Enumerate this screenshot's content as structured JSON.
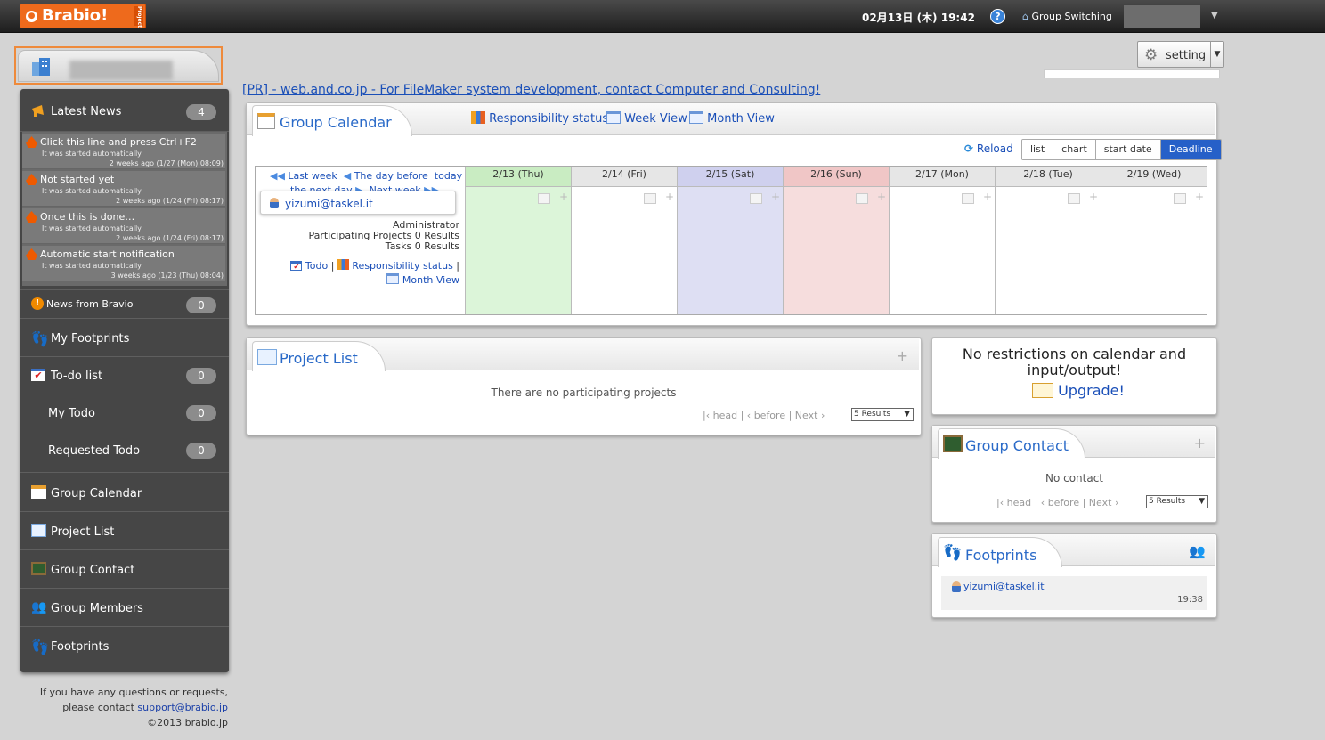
{
  "topbar": {
    "logo": "Brabio!",
    "logo_tag": "Project",
    "datetime": "02月13日 (木) 19:42",
    "help": "?",
    "group_switching": "Group Switching"
  },
  "setting": {
    "label": "setting"
  },
  "pr_link": "[PR] - web.and.co.jp - For FileMaker system development, contact Computer and Consulting!",
  "sidebar": {
    "latest_news": {
      "label": "Latest News",
      "count": "4"
    },
    "news": [
      {
        "title": "Click this line and press Ctrl+F2",
        "sub": "It was started automatically",
        "date": "2 weeks ago (1/27 (Mon) 08:09)"
      },
      {
        "title": "Not started yet",
        "sub": "It was started automatically",
        "date": "2 weeks ago (1/24 (Fri) 08:17)"
      },
      {
        "title": "Once this is done…",
        "sub": "It was started automatically",
        "date": "2 weeks ago (1/24 (Fri) 08:17)"
      },
      {
        "title": "Automatic start notification",
        "sub": "It was started automatically",
        "date": "3 weeks ago (1/23 (Thu) 08:04)"
      }
    ],
    "news_bravio": {
      "label": "News from Bravio",
      "count": "0"
    },
    "my_footprints": "My Footprints",
    "todo_list": {
      "label": "To-do list",
      "count": "0"
    },
    "my_todo": {
      "label": "My Todo",
      "count": "0"
    },
    "requested_todo": {
      "label": "Requested Todo",
      "count": "0"
    },
    "group_calendar": "Group Calendar",
    "project_list": "Project List",
    "group_contact": "Group Contact",
    "group_members": "Group Members",
    "footprints": "Footprints"
  },
  "footer": {
    "line1": "If you have any questions or requests,",
    "line2": "please contact",
    "email": "support@brabio.jp",
    "copyright": "©2013 brabio.jp"
  },
  "calendar": {
    "title": "Group Calendar",
    "links": [
      "Responsibility status",
      "Week View",
      "Month View"
    ],
    "reload": "Reload",
    "view_buttons": [
      "list",
      "chart",
      "start date",
      "Deadline"
    ],
    "nav": {
      "last_week": "Last week",
      "day_before": "The day before",
      "today": "today",
      "next_day": "the next day",
      "next_week": "Next week"
    },
    "user": "yizumi@taskel.it",
    "role": "Administrator",
    "participating_projects": "Participating Projects",
    "projects_count": "0 Results",
    "tasks": "Tasks",
    "tasks_count": "0 Results",
    "user_links": [
      "Todo",
      "Responsibility status",
      "Month View"
    ],
    "days": [
      "2/13 (Thu)",
      "2/14 (Fri)",
      "2/15 (Sat)",
      "2/16 (Sun)",
      "2/17 (Mon)",
      "2/18 (Tue)",
      "2/19 (Wed)"
    ],
    "day_colors": [
      "#dcf5d9",
      "#ffffff",
      "#dedff3",
      "#f6dddd",
      "#ffffff",
      "#ffffff",
      "#ffffff"
    ],
    "header_colors": [
      "#c9ecc2",
      "#e6e6e6",
      "#cfd0ee",
      "#f0c6c6",
      "#e6e6e6",
      "#e6e6e6",
      "#e6e6e6"
    ]
  },
  "project_list": {
    "title": "Project List",
    "empty": "There are no participating projects",
    "pager": {
      "head": "head",
      "before": "before",
      "next": "Next",
      "results": "5 Results"
    }
  },
  "upgrade": {
    "line1": "No restrictions on calendar and",
    "line2": "input/output!",
    "link": "Upgrade!"
  },
  "group_contact": {
    "title": "Group Contact",
    "empty": "No contact",
    "pager": {
      "head": "head",
      "before": "before",
      "next": "Next",
      "results": "5 Results"
    }
  },
  "footprints": {
    "title": "Footprints",
    "user": "yizumi@taskel.it",
    "time": "19:38"
  }
}
